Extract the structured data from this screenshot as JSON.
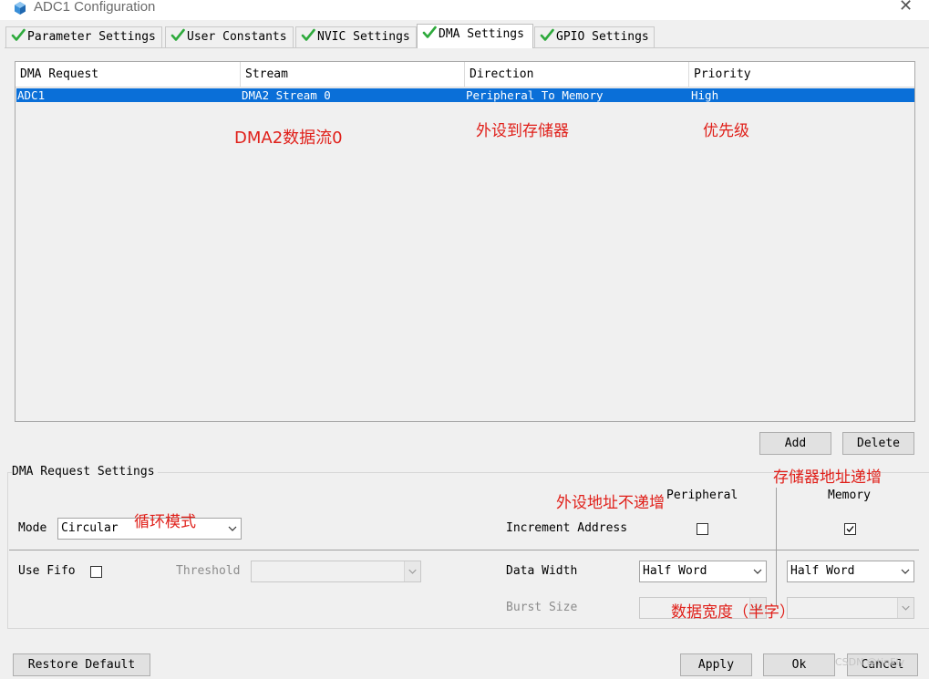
{
  "window": {
    "title": "ADC1 Configuration",
    "close_glyph": "✕"
  },
  "tabs": [
    {
      "label": "Parameter Settings",
      "icon": "check-icon",
      "active": false
    },
    {
      "label": "User Constants",
      "icon": "check-icon",
      "active": false
    },
    {
      "label": "NVIC Settings",
      "icon": "check-icon",
      "active": false
    },
    {
      "label": "DMA Settings",
      "icon": "check-icon",
      "active": true
    },
    {
      "label": "GPIO Settings",
      "icon": "check-icon",
      "active": false
    }
  ],
  "table": {
    "headers": [
      "DMA Request",
      "Stream",
      "Direction",
      "Priority"
    ],
    "rows": [
      [
        "ADC1",
        "DMA2 Stream 0",
        "Peripheral To Memory",
        "High"
      ]
    ]
  },
  "table_buttons": {
    "add": "Add",
    "delete": "Delete"
  },
  "settings": {
    "group_title": "DMA Request Settings",
    "mode_label": "Mode",
    "mode_value": "Circular",
    "peripheral_header": "Peripheral",
    "memory_header": "Memory",
    "increment_label": "Increment Address",
    "increment_peripheral": false,
    "increment_memory": true,
    "use_fifo_label": "Use Fifo",
    "use_fifo": false,
    "threshold_label": "Threshold",
    "threshold_value": "",
    "data_width_label": "Data Width",
    "data_width_peripheral": "Half Word",
    "data_width_memory": "Half Word",
    "burst_size_label": "Burst Size",
    "burst_peripheral": "",
    "burst_memory": ""
  },
  "annotations": {
    "stream": "DMA2数据流0",
    "direction": "外设到存储器",
    "priority": "优先级",
    "mode": "循环模式",
    "periph_inc": "外设地址不递增",
    "mem_inc": "存储器地址递增",
    "data_width": "数据宽度（半字）"
  },
  "footer": {
    "restore": "Restore Default",
    "apply": "Apply",
    "ok": "Ok",
    "cancel": "Cancel"
  },
  "watermark": "CSDN @tinFly",
  "colors": {
    "selection": "#0a6fd8",
    "annotation": "#e0201a",
    "check": "#2eaa3c"
  }
}
